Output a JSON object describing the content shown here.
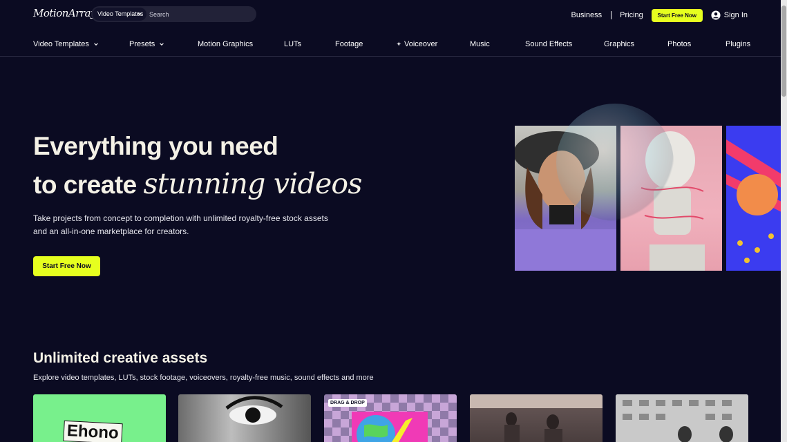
{
  "brand": {
    "logo_text": "MotionArray",
    "accent": "#e6ff1f",
    "background": "#0b0b22"
  },
  "search": {
    "category": "Video Templates",
    "placeholder": "Search"
  },
  "header": {
    "business": "Business",
    "pricing": "Pricing",
    "cta": "Start Free Now",
    "signin": "Sign In"
  },
  "nav": {
    "items": [
      {
        "label": "Video Templates",
        "has_dropdown": true
      },
      {
        "label": "Presets",
        "has_dropdown": true
      },
      {
        "label": "Motion Graphics"
      },
      {
        "label": "LUTs"
      },
      {
        "label": "Footage"
      },
      {
        "label": "Voiceover",
        "icon": "sparkle-icon"
      },
      {
        "label": "Music"
      },
      {
        "label": "Sound Effects"
      },
      {
        "label": "Graphics"
      },
      {
        "label": "Photos"
      },
      {
        "label": "Plugins"
      }
    ]
  },
  "hero": {
    "title_line1": "Everything you need",
    "title_line2_prefix": "to create",
    "title_line2_emphasis": "stunning videos",
    "subtitle": "Take projects from concept to completion with unlimited royalty-free stock assets and an all-in-one marketplace for creators.",
    "cta": "Start Free Now"
  },
  "assets": {
    "title": "Unlimited creative assets",
    "subtitle": "Explore video templates, LUTs, stock footage, voiceovers, royalty-free music, sound effects and more",
    "cards": [
      {
        "text": "Ehono"
      },
      {
        "text": ""
      },
      {
        "badge": "DRAG & DROP"
      },
      {
        "text": ""
      },
      {
        "text": ""
      }
    ]
  }
}
